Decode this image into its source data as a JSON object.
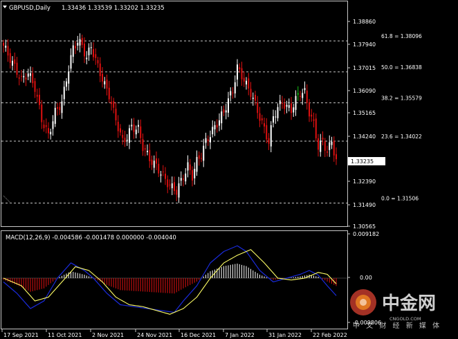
{
  "header": {
    "symbol_label": "GBPUSD,Daily",
    "ohlc_label": "1.33436 1.33539 1.33202 1.33235"
  },
  "macd_header": {
    "label": "MACD(12,26,9) -0.004586 -0.001478 0.000000 -0.004040"
  },
  "price_axis": {
    "ticks": [
      "1.38860",
      "1.37940",
      "1.37015",
      "1.36090",
      "1.35165",
      "1.34240",
      "1.33235",
      "1.32390",
      "1.31490",
      "1.30565"
    ],
    "current_price": "1.33235"
  },
  "macd_axis": {
    "ticks": [
      "0.009182",
      "0.00",
      "-0.009806"
    ]
  },
  "time_axis": {
    "labels": [
      "17 Sep 2021",
      "11 Oct 2021",
      "2 Nov 2021",
      "24 Nov 2021",
      "16 Dec 2021",
      "7 Jan 2022",
      "31 Jan 2022",
      "22 Feb 2022"
    ]
  },
  "fibonacci": {
    "levels": [
      {
        "label": "61.8 = 1.38096"
      },
      {
        "label": "50.0 = 1.36838"
      },
      {
        "label": "38.2 = 1.35579"
      },
      {
        "label": "23.6 = 1.34022"
      },
      {
        "label": "0.0 = 1.31506"
      }
    ]
  },
  "watermark": {
    "brand": "中金网",
    "url": "CNGOLD.COM",
    "tagline": "中 文 财 经 新 媒 体"
  },
  "colors": {
    "background": "#000000",
    "bull": "#ffffff",
    "bear": "#e01010",
    "doji": "#19c419",
    "signal": "#ffff66",
    "macd_line": "#1a2bdc",
    "grid": "#c8c8c8"
  },
  "chart_data": {
    "type": "candlestick",
    "symbol": "GBPUSD",
    "timeframe": "Daily",
    "ylim": [
      1.30565,
      1.3886
    ],
    "fib_levels": [
      1.38096,
      1.36838,
      1.35579,
      1.34022,
      1.31506
    ],
    "close_path": [
      [
        0,
        1.379
      ],
      [
        4,
        1.372
      ],
      [
        8,
        1.365
      ],
      [
        11,
        1.368
      ],
      [
        14,
        1.362
      ],
      [
        17,
        1.349
      ],
      [
        20,
        1.3425
      ],
      [
        23,
        1.352
      ],
      [
        26,
        1.356
      ],
      [
        29,
        1.37
      ],
      [
        31,
        1.378
      ],
      [
        33,
        1.381
      ],
      [
        35,
        1.379
      ],
      [
        37,
        1.374
      ],
      [
        39,
        1.379
      ],
      [
        41,
        1.373
      ],
      [
        43,
        1.368
      ],
      [
        45,
        1.363
      ],
      [
        47,
        1.359
      ],
      [
        49,
        1.352
      ],
      [
        51,
        1.346
      ],
      [
        53,
        1.34
      ],
      [
        55,
        1.342
      ],
      [
        57,
        1.346
      ],
      [
        60,
        1.345
      ],
      [
        62,
        1.338
      ],
      [
        65,
        1.333
      ],
      [
        68,
        1.33
      ],
      [
        71,
        1.326
      ],
      [
        74,
        1.322
      ],
      [
        77,
        1.32
      ],
      [
        80,
        1.326
      ],
      [
        82,
        1.33
      ],
      [
        84,
        1.326
      ],
      [
        86,
        1.332
      ],
      [
        88,
        1.335
      ],
      [
        90,
        1.34
      ],
      [
        92,
        1.343
      ],
      [
        94,
        1.346
      ],
      [
        96,
        1.349
      ],
      [
        98,
        1.352
      ],
      [
        100,
        1.357
      ],
      [
        102,
        1.361
      ],
      [
        104,
        1.37
      ],
      [
        106,
        1.367
      ],
      [
        108,
        1.363
      ],
      [
        110,
        1.36
      ],
      [
        112,
        1.355
      ],
      [
        114,
        1.35
      ],
      [
        116,
        1.345
      ],
      [
        118,
        1.34
      ],
      [
        120,
        1.35
      ],
      [
        122,
        1.354
      ],
      [
        124,
        1.356
      ],
      [
        126,
        1.354
      ],
      [
        128,
        1.353
      ],
      [
        130,
        1.357
      ],
      [
        132,
        1.36
      ],
      [
        134,
        1.36
      ],
      [
        136,
        1.352
      ],
      [
        138,
        1.347
      ],
      [
        140,
        1.338
      ],
      [
        142,
        1.34
      ],
      [
        144,
        1.336
      ],
      [
        146,
        1.34
      ],
      [
        148,
        1.3324
      ]
    ],
    "macd_main_path": [
      [
        0,
        -0.001
      ],
      [
        6,
        -0.004
      ],
      [
        12,
        -0.008
      ],
      [
        18,
        -0.006
      ],
      [
        24,
        0.0
      ],
      [
        30,
        0.004
      ],
      [
        36,
        0.002
      ],
      [
        40,
        0.0
      ],
      [
        46,
        -0.004
      ],
      [
        52,
        -0.007
      ],
      [
        58,
        -0.0075
      ],
      [
        64,
        -0.008
      ],
      [
        70,
        -0.0085
      ],
      [
        76,
        -0.009
      ],
      [
        80,
        -0.006
      ],
      [
        86,
        -0.002
      ],
      [
        92,
        0.004
      ],
      [
        98,
        0.007
      ],
      [
        104,
        0.0085
      ],
      [
        108,
        0.007
      ],
      [
        114,
        0.002
      ],
      [
        120,
        -0.001
      ],
      [
        126,
        0.0
      ],
      [
        132,
        0.001
      ],
      [
        136,
        0.002
      ],
      [
        140,
        0.0008
      ],
      [
        144,
        -0.002
      ],
      [
        148,
        -0.0046
      ]
    ],
    "macd_signal_path": [
      [
        0,
        0.0
      ],
      [
        8,
        -0.002
      ],
      [
        14,
        -0.006
      ],
      [
        20,
        -0.005
      ],
      [
        26,
        -0.001
      ],
      [
        32,
        0.003
      ],
      [
        38,
        0.002
      ],
      [
        44,
        -0.001
      ],
      [
        50,
        -0.005
      ],
      [
        56,
        -0.007
      ],
      [
        62,
        -0.0075
      ],
      [
        68,
        -0.0085
      ],
      [
        74,
        -0.0095
      ],
      [
        80,
        -0.008
      ],
      [
        86,
        -0.005
      ],
      [
        92,
        0.0
      ],
      [
        98,
        0.004
      ],
      [
        104,
        0.006
      ],
      [
        110,
        0.0075
      ],
      [
        116,
        0.004
      ],
      [
        122,
        0.0
      ],
      [
        128,
        -0.0005
      ],
      [
        134,
        0.0
      ],
      [
        140,
        0.0015
      ],
      [
        144,
        0.001
      ],
      [
        148,
        -0.0015
      ]
    ]
  }
}
